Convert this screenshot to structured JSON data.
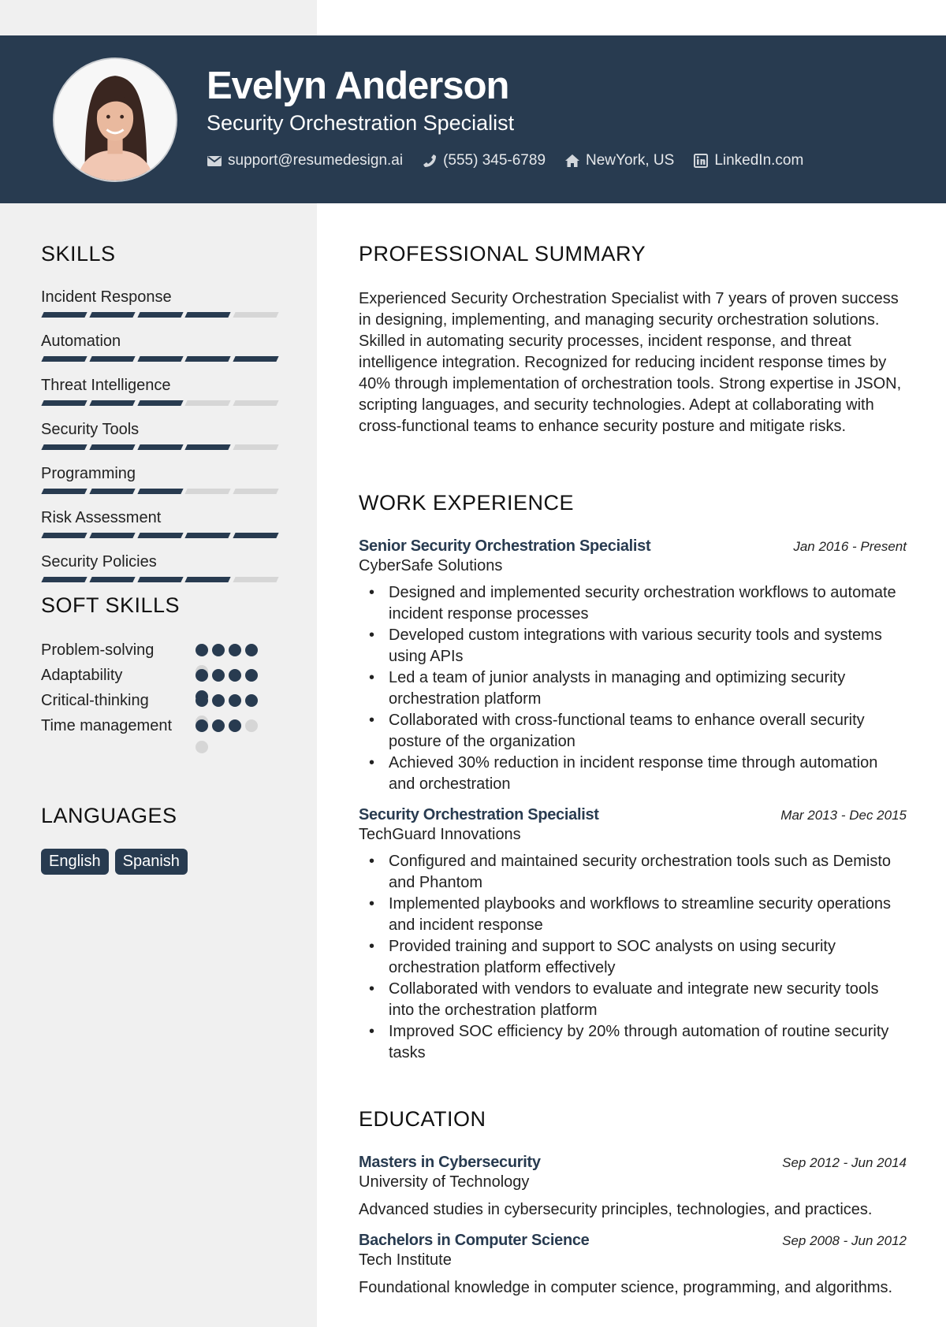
{
  "header": {
    "name": "Evelyn Anderson",
    "title": "Security Orchestration Specialist",
    "contacts": [
      {
        "icon": "envelope-icon",
        "text": "support@resumedesign.ai"
      },
      {
        "icon": "phone-icon",
        "text": "(555) 345-6789"
      },
      {
        "icon": "home-icon",
        "text": "NewYork, US"
      },
      {
        "icon": "linkedin-icon",
        "text": "LinkedIn.com"
      }
    ]
  },
  "colors": {
    "primary": "#283b50",
    "sidebar_bg": "#f0f0f0",
    "inactive": "#d6d6d6"
  },
  "skills": {
    "title": "SKILLS",
    "max": 5,
    "items": [
      {
        "label": "Incident Response",
        "level": 4
      },
      {
        "label": "Automation",
        "level": 5
      },
      {
        "label": "Threat Intelligence",
        "level": 3
      },
      {
        "label": "Security Tools",
        "level": 4
      },
      {
        "label": "Programming",
        "level": 3
      },
      {
        "label": "Risk Assessment",
        "level": 5
      },
      {
        "label": "Security Policies",
        "level": 4
      }
    ]
  },
  "soft_skills": {
    "title": "SOFT SKILLS",
    "max": 5,
    "items": [
      {
        "label": "Problem-solving",
        "level": 4
      },
      {
        "label": "Adaptability",
        "level": 5
      },
      {
        "label": "Critical-thinking",
        "level": 4
      },
      {
        "label": "Time management",
        "level": 3
      }
    ]
  },
  "languages": {
    "title": "LANGUAGES",
    "items": [
      "English",
      "Spanish"
    ]
  },
  "summary": {
    "title": "PROFESSIONAL SUMMARY",
    "text": "Experienced Security Orchestration Specialist with 7 years of proven success in designing, implementing, and managing security orchestration solutions. Skilled in automating security processes, incident response, and threat intelligence integration. Recognized for reducing incident response times by 40% through implementation of orchestration tools. Strong expertise in JSON, scripting languages, and security technologies. Adept at collaborating with cross-functional teams to enhance security posture and mitigate risks."
  },
  "experience": {
    "title": "WORK EXPERIENCE",
    "jobs": [
      {
        "role": "Senior Security Orchestration Specialist",
        "date": "Jan 2016 - Present",
        "company": "CyberSafe Solutions",
        "bullets": [
          "Designed and implemented security orchestration workflows to automate incident response processes",
          "Developed custom integrations with various security tools and systems using APIs",
          "Led a team of junior analysts in managing and optimizing security orchestration platform",
          "Collaborated with cross-functional teams to enhance overall security posture of the organization",
          "Achieved 30% reduction in incident response time through automation and orchestration"
        ]
      },
      {
        "role": "Security Orchestration Specialist",
        "date": "Mar 2013 - Dec 2015",
        "company": "TechGuard Innovations",
        "bullets": [
          "Configured and maintained security orchestration tools such as Demisto and Phantom",
          "Implemented playbooks and workflows to streamline security operations and incident response",
          "Provided training and support to SOC analysts on using security orchestration platform effectively",
          "Collaborated with vendors to evaluate and integrate new security tools into the orchestration platform",
          "Improved SOC efficiency by 20% through automation of routine security tasks"
        ]
      }
    ]
  },
  "education": {
    "title": "EDUCATION",
    "items": [
      {
        "degree": "Masters in Cybersecurity",
        "date": "Sep 2012 - Jun 2014",
        "school": "University of Technology",
        "desc": "Advanced studies in cybersecurity principles, technologies, and practices."
      },
      {
        "degree": "Bachelors in Computer Science",
        "date": "Sep 2008 - Jun 2012",
        "school": "Tech Institute",
        "desc": "Foundational knowledge in computer science, programming, and algorithms."
      }
    ]
  }
}
